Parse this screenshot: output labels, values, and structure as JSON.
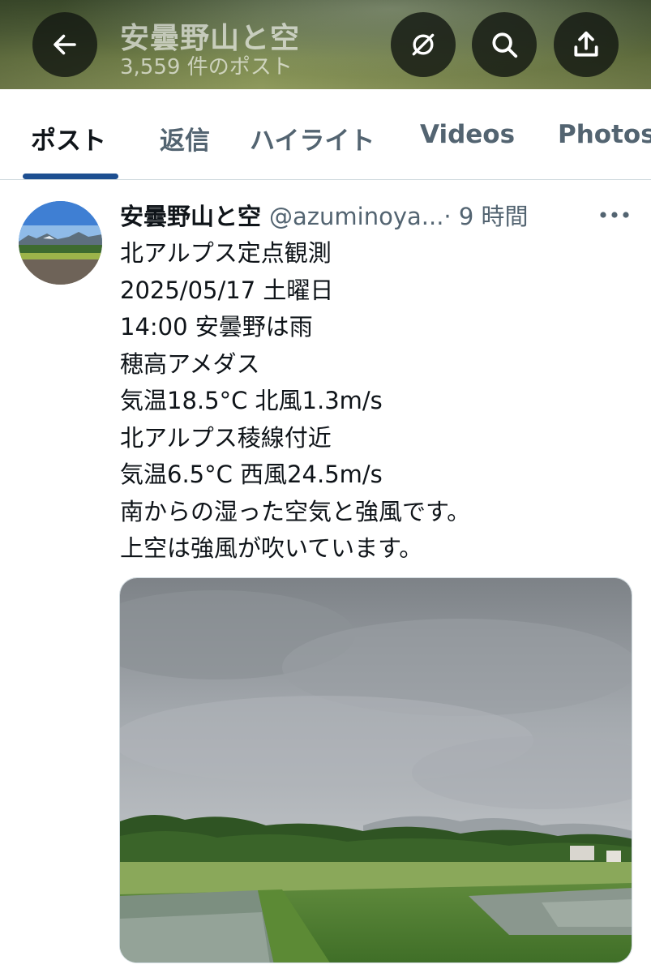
{
  "header": {
    "title": "安曇野山と空",
    "post_count": "3,559 件のポスト",
    "back_icon": "arrow-left-icon",
    "hide_icon": "eye-slash-icon",
    "search_icon": "search-icon",
    "share_icon": "share-icon"
  },
  "tabs": [
    {
      "label": "ポスト",
      "active": true
    },
    {
      "label": "返信"
    },
    {
      "label": "ハイライト"
    },
    {
      "label": "Videos"
    },
    {
      "label": "Photos"
    }
  ],
  "post": {
    "author_name": "安曇野山と空",
    "handle": "@azuminoya...",
    "time": "· 9 時間",
    "lines": [
      "北アルプス定点観測",
      "2025/05/17 土曜日",
      "14:00 安曇野は雨",
      "穂高アメダス",
      "気温18.5°C 北風1.3m/s",
      "北アルプス稜線付近",
      "気温6.5°C 西風24.5m/s",
      "南からの湿った空気と強風です。",
      "上空は強風が吹いています。"
    ]
  },
  "colors": {
    "accent": "#1d4f91",
    "text": "#0f1419",
    "muted": "#536471"
  }
}
